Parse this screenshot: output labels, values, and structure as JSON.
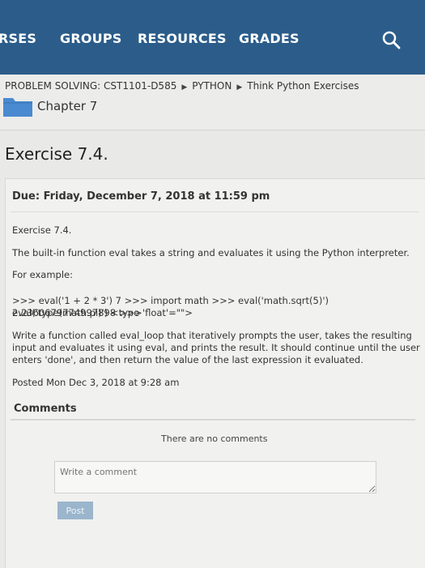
{
  "nav": {
    "items": [
      "RSES",
      "GROUPS",
      "RESOURCES",
      "GRADES"
    ]
  },
  "breadcrumb": {
    "items": [
      "PROBLEM SOLVING: CST1101-D585",
      "PYTHON",
      "Think Python Exercises"
    ],
    "separator": "▶"
  },
  "chapter": {
    "title": "Chapter 7"
  },
  "exercise": {
    "heading": "Exercise 7.4."
  },
  "assignment": {
    "due": "Due: Friday, December 7, 2018 at 11:59 pm",
    "body_title": "Exercise 7.4.",
    "description": "The built-in function eval takes a string and evaluates it using the Python interpreter.",
    "for_example": "For example:",
    "code_line_1": ">>> eval('1 + 2 * 3') 7 >>> import math >>> eval('math.sqrt(5)') 2.2360679774997898 >>>",
    "code_line_2": "eval('type(math.pi)') <type 'float'=\"\">",
    "task_line_1": "Write a function called eval_loop that iteratively prompts the user, takes the resulting",
    "task_line_2": "input and evaluates it using eval, and prints the result. It should continue until the user",
    "task_line_3": "enters 'done', and then return the value of the last expression it evaluated.",
    "posted": "Posted Mon Dec 3, 2018 at 9:28 am"
  },
  "comments": {
    "title": "Comments",
    "empty_text": "There are no comments",
    "placeholder": "Write a comment",
    "post_label": "Post"
  },
  "colors": {
    "nav_bg": "#2c5d8a",
    "post_button": "#9bb5cc",
    "folder": "#4a8ad0"
  }
}
